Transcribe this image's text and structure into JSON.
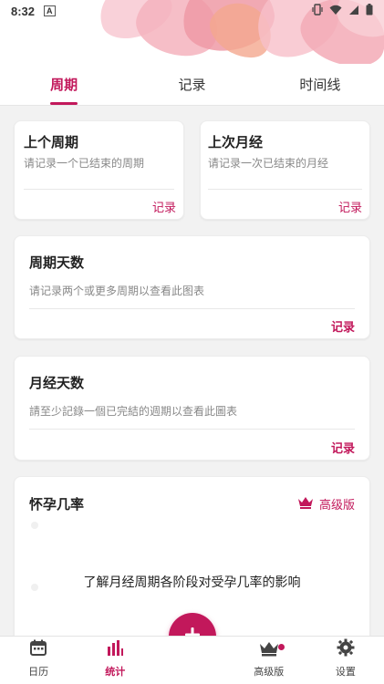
{
  "status_bar": {
    "time": "8:32",
    "notif_letter": "A"
  },
  "tabs": [
    {
      "label": "周期",
      "active": true
    },
    {
      "label": "记录",
      "active": false
    },
    {
      "label": "时间线",
      "active": false
    }
  ],
  "cards": {
    "last_cycle": {
      "title": "上个周期",
      "subtitle": "请记录一个已结束的周期",
      "action": "记录"
    },
    "last_period": {
      "title": "上次月经",
      "subtitle": "请记录一次已结束的月经",
      "action": "记录"
    },
    "cycle_days": {
      "title": "周期天数",
      "subtitle": "请记录两个或更多周期以查看此图表",
      "action": "记录"
    },
    "period_days": {
      "title": "月经天数",
      "subtitle": "請至少記錄一個已完結的週期以查看此圖表",
      "action": "记录"
    },
    "fertility": {
      "title": "怀孕几率",
      "premium_label": "高级版",
      "description": "了解月经周期各阶段对受孕几率的影响"
    }
  },
  "bottom_nav": [
    {
      "label": "日历",
      "icon": "calendar-icon",
      "active": false
    },
    {
      "label": "统计",
      "icon": "bar-chart-icon",
      "active": true
    },
    {
      "label": "高级版",
      "icon": "crown-icon",
      "active": false,
      "badge": true
    },
    {
      "label": "设置",
      "icon": "gear-icon",
      "active": false
    }
  ],
  "fab": {
    "icon": "plus-icon"
  },
  "colors": {
    "accent": "#c2185b",
    "background": "#f2f2f2",
    "card": "#ffffff"
  }
}
